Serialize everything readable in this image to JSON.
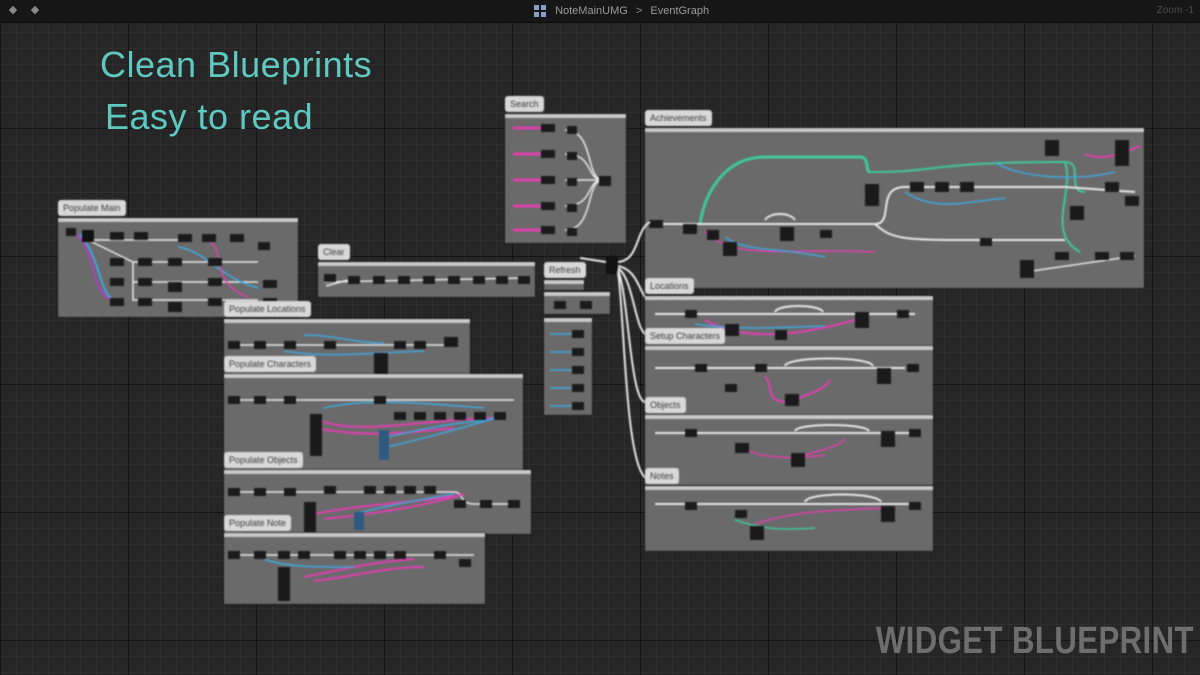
{
  "toolbar": {
    "back_icon": "back-arrow-icon",
    "forward_icon": "forward-arrow-icon",
    "blueprint_icon": "widget-blueprint-icon",
    "breadcrumb": [
      "NoteMainUMG",
      "EventGraph"
    ],
    "zoom_text": "Zoom -1"
  },
  "headline": {
    "line1": "Clean Blueprints",
    "line2": "Easy to read",
    "color": "#5fc8c0"
  },
  "watermark": "WIDGET BLUEPRINT",
  "comments": {
    "populate_main": "Populate Main",
    "clear": "Clear",
    "search": "Search",
    "achievements": "Achievements",
    "refresh": "Refresh",
    "populate_locations": "Populate Locations",
    "populate_characters": "Populate Characters",
    "populate_objects": "Populate Objects",
    "populate_note": "Populate Note",
    "locations": "Locations",
    "setup_characters": "Setup Characters",
    "objects": "Objects",
    "notes": "Notes"
  },
  "wire_colors": {
    "exec": "#e8e8e8",
    "object": "#3fa8e0",
    "string": "#e040b0",
    "bool": "#3ec89a"
  }
}
